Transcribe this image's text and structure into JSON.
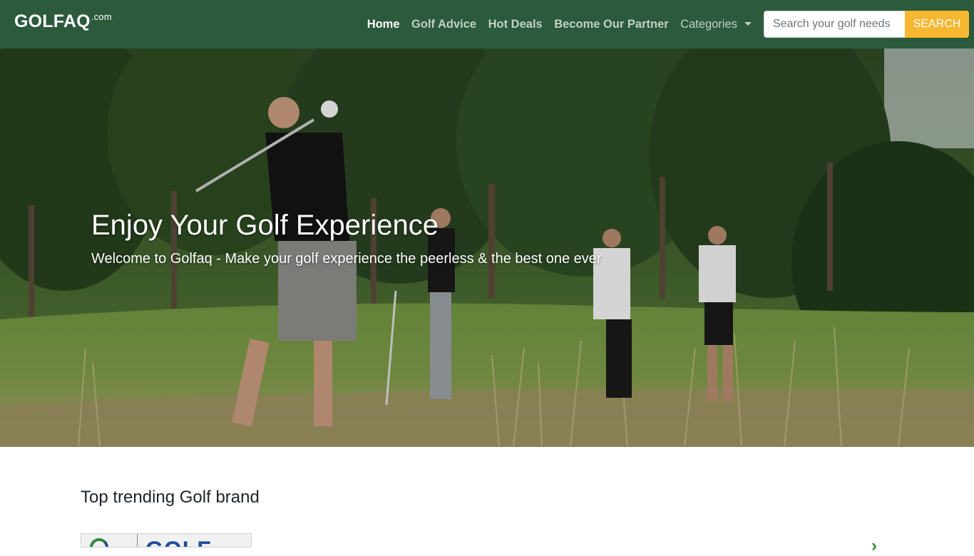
{
  "navbar": {
    "brand": "GOLFAQ",
    "brand_tld": ".com",
    "links": [
      {
        "label": "Home",
        "active": true
      },
      {
        "label": "Golf Advice",
        "active": false
      },
      {
        "label": "Hot Deals",
        "active": false
      },
      {
        "label": "Become Our Partner",
        "active": false
      }
    ],
    "categories_label": "Categories",
    "search_placeholder": "Search your golf needs",
    "search_button": "SEARCH"
  },
  "hero": {
    "title": "Enjoy Your Golf Experience",
    "subtitle": "Welcome to Golfaq - Make your golf experience the peerless & the best one ever"
  },
  "trending": {
    "title": "Top trending Golf brand",
    "first_brand_logo_text": "GOLF"
  },
  "colors": {
    "navbar_bg": "#2b5a3c",
    "search_button": "#f7b731",
    "nav_link": "#c2d1c6",
    "nav_link_active": "#ffffff"
  },
  "icons": {
    "categories_caret": "chevron-down-icon",
    "carousel_next": "chevron-right-icon"
  }
}
